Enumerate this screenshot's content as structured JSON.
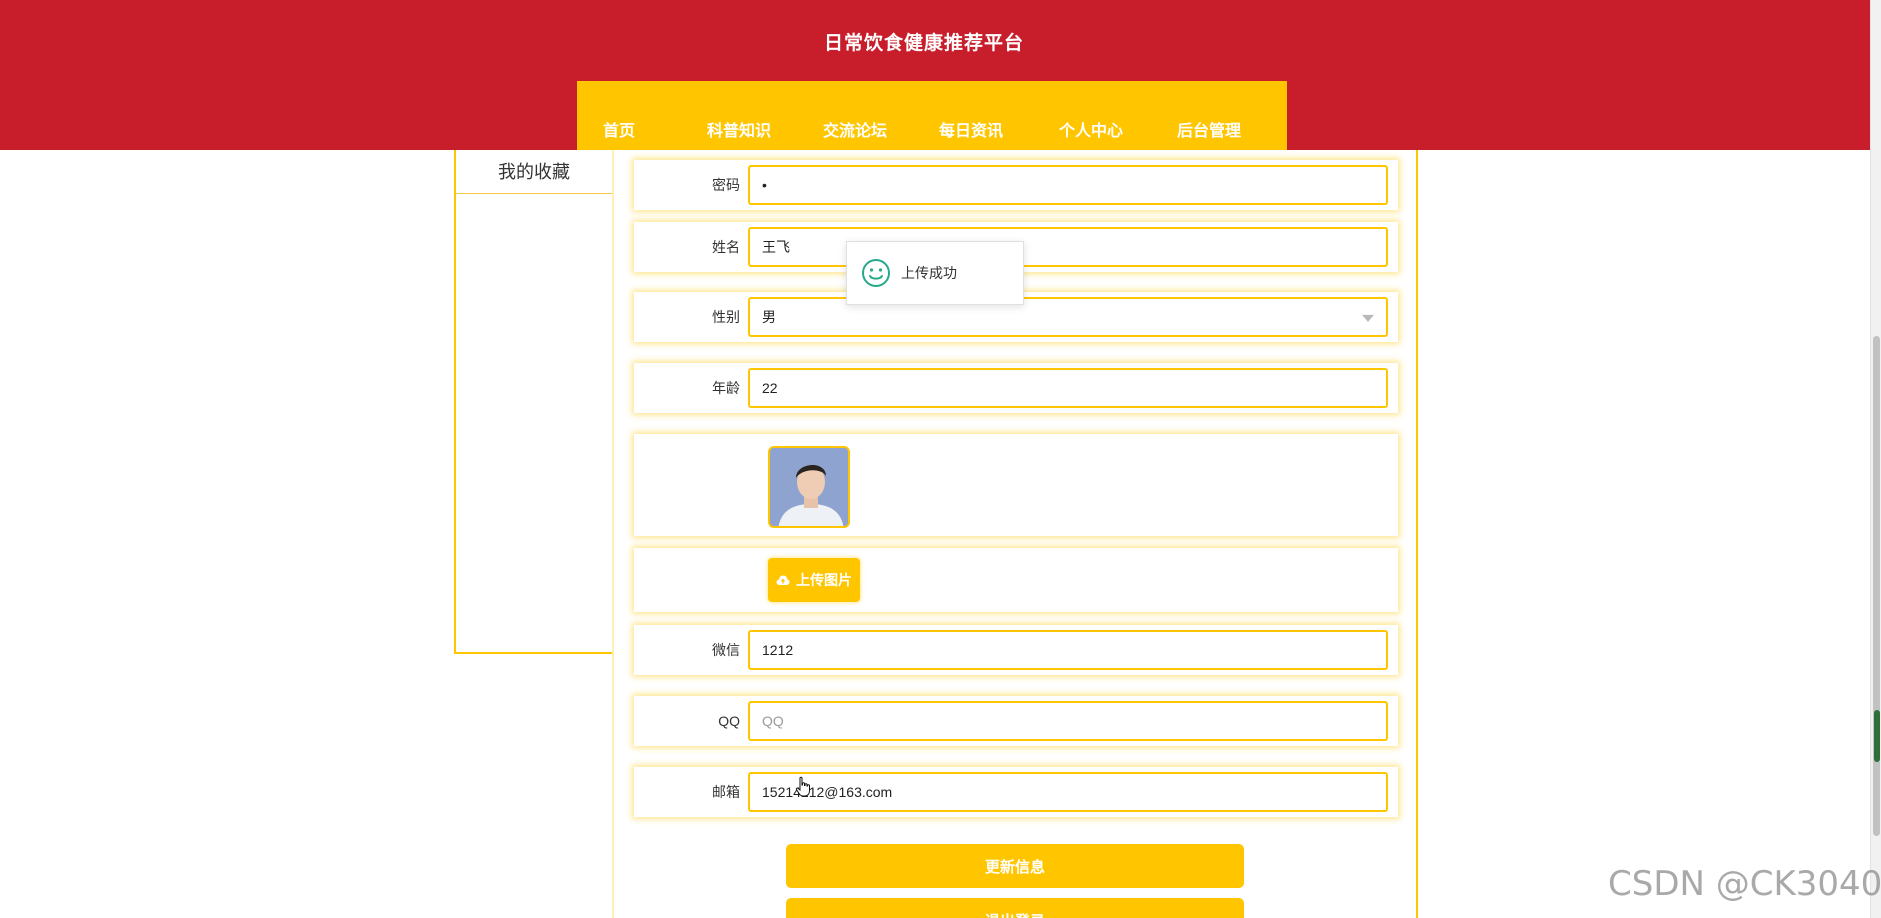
{
  "header": {
    "title": "日常饮食健康推荐平台",
    "nav": [
      "首页",
      "科普知识",
      "交流论坛",
      "每日资讯",
      "个人中心",
      "后台管理"
    ]
  },
  "sidebar": {
    "favorites_label": "我的收藏"
  },
  "form": {
    "password": {
      "label": "密码",
      "value": "•"
    },
    "name": {
      "label": "姓名",
      "value": "王飞"
    },
    "gender": {
      "label": "性别",
      "value": "男"
    },
    "age": {
      "label": "年龄",
      "value": "22"
    },
    "upload_label": "上传图片",
    "wechat": {
      "label": "微信",
      "value": "1212"
    },
    "qq": {
      "label": "QQ",
      "value": "",
      "placeholder": "QQ"
    },
    "email": {
      "label": "邮箱",
      "value": "15214212@163.com"
    }
  },
  "buttons": {
    "update": "更新信息",
    "logout": "退出登录"
  },
  "toast": {
    "message": "上传成功",
    "icon": "smile-icon",
    "color": "#26a88a"
  },
  "colors": {
    "header_red": "#c81d2b",
    "accent_yellow": "#ffc600"
  },
  "watermark": "CSDN @CK3040"
}
